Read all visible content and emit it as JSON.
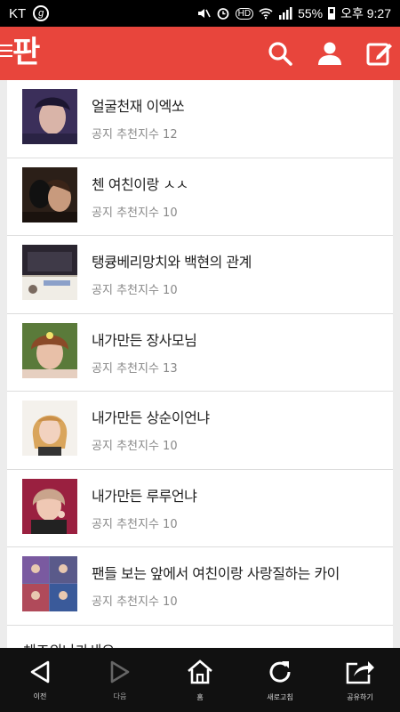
{
  "status_bar": {
    "carrier": "KT",
    "g_badge": "g",
    "battery": "55%",
    "time": "오후 9:27",
    "hd": "HD"
  },
  "app": {
    "logo": "판"
  },
  "posts": [
    {
      "title": "얼굴천재 이엑쏘",
      "notice": "공지",
      "recommend_label": "추천지수",
      "score": "12",
      "thumb": "photo-1"
    },
    {
      "title": "첸 여친이랑 ㅅㅅ",
      "notice": "공지",
      "recommend_label": "추천지수",
      "score": "10",
      "thumb": "photo-2"
    },
    {
      "title": "탱큥베리망치와 백현의 관계",
      "notice": "공지",
      "recommend_label": "추천지수",
      "score": "10",
      "thumb": "photo-3"
    },
    {
      "title": "내가만든 장사모님",
      "notice": "공지",
      "recommend_label": "추천지수",
      "score": "13",
      "thumb": "photo-4"
    },
    {
      "title": "내가만든 상순이언냐",
      "notice": "공지",
      "recommend_label": "추천지수",
      "score": "10",
      "thumb": "photo-5"
    },
    {
      "title": "내가만든 루루언냐",
      "notice": "공지",
      "recommend_label": "추천지수",
      "score": "10",
      "thumb": "photo-6"
    },
    {
      "title": "팬들 보는 앞에서 여친이랑 사랑질하는 카이",
      "notice": "공지",
      "recommend_label": "추천지수",
      "score": "10",
      "thumb": "photo-7"
    }
  ],
  "partial_post": {
    "title": "체조외나가세요"
  },
  "bottom_nav": {
    "prev": "이전",
    "next": "다음",
    "home": "홈",
    "refresh": "새로고침",
    "share": "공유하기"
  }
}
